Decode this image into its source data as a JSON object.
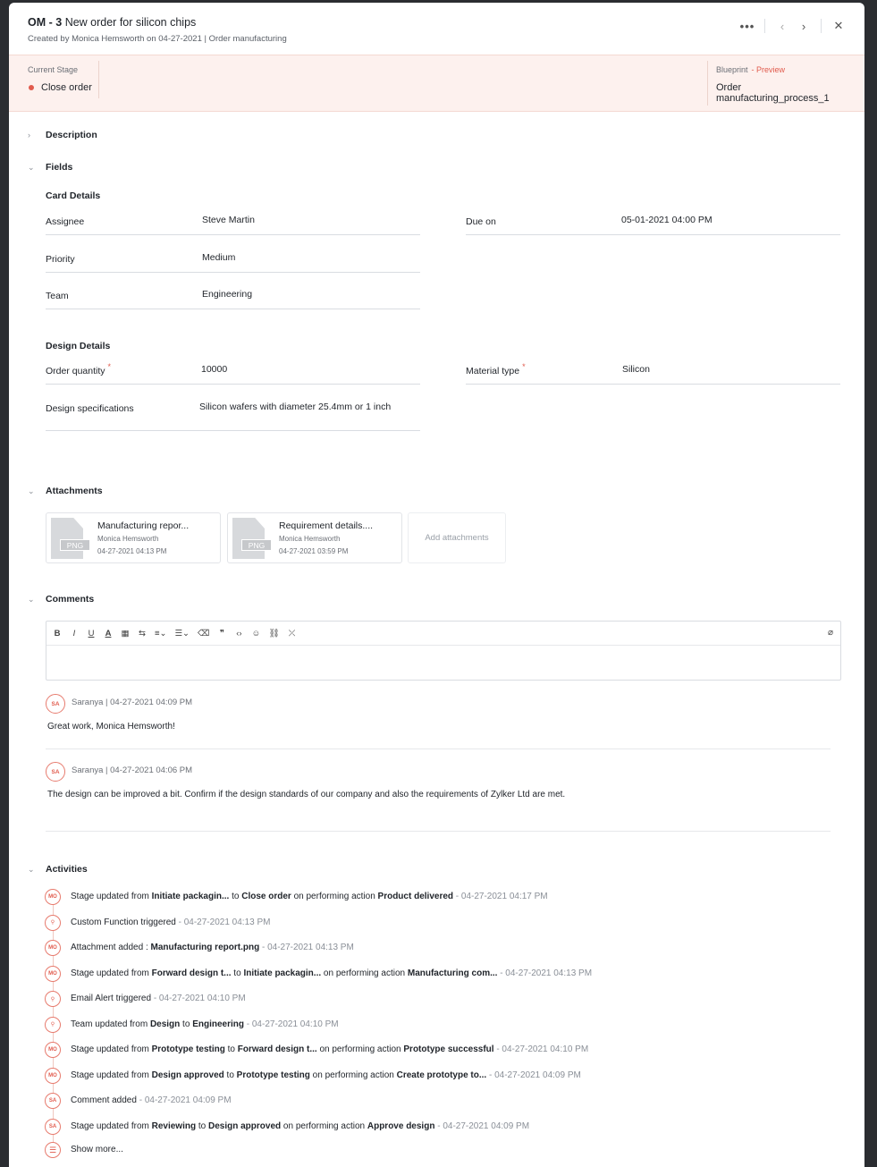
{
  "header": {
    "id": "OM - 3",
    "title": "New order for silicon chips",
    "subtitle": "Created by Monica Hemsworth on 04-27-2021 | Order manufacturing"
  },
  "stage": {
    "label": "Current Stage",
    "value": "Close order",
    "dot_color": "#e15b4d",
    "blueprint_label": "Blueprint",
    "preview_label": "- Preview",
    "blueprint_value": "Order manufacturing_process_1"
  },
  "sections": {
    "description": "Description",
    "fields": "Fields",
    "attachments": "Attachments",
    "comments": "Comments",
    "activities": "Activities"
  },
  "card_details": {
    "heading": "Card Details",
    "assignee_label": "Assignee",
    "assignee": "Steve Martin",
    "due_label": "Due on",
    "due": "05-01-2021 04:00 PM",
    "priority_label": "Priority",
    "priority": "Medium",
    "team_label": "Team",
    "team": "Engineering"
  },
  "design_details": {
    "heading": "Design Details",
    "qty_label": "Order quantity",
    "qty": "10000",
    "material_label": "Material type",
    "material": "Silicon",
    "spec_label": "Design specifications",
    "spec": "Silicon wafers with diameter 25.4mm or 1 inch"
  },
  "attachments": [
    {
      "name": "Manufacturing repor...",
      "by": "Monica Hemsworth",
      "date": "04-27-2021 04:13 PM",
      "type": "PNG"
    },
    {
      "name": "Requirement details....",
      "by": "Monica Hemsworth",
      "date": "04-27-2021 03:59 PM",
      "type": "PNG"
    }
  ],
  "add_attachments": "Add attachments",
  "comments": [
    {
      "initials": "SA",
      "meta": "Saranya | 04-27-2021 04:09 PM",
      "body": "Great work, Monica Hemsworth!"
    },
    {
      "initials": "SA",
      "meta": "Saranya | 04-27-2021 04:06 PM",
      "body": "The design can be improved a bit. Confirm if the design standards of our company and also the requirements of Zylker Ltd are met."
    }
  ],
  "activities": [
    {
      "initials": "MO",
      "parts": [
        "Stage updated from ",
        "Initiate packagin...",
        " to ",
        "Close order",
        " on performing action ",
        "Product delivered"
      ],
      "ts": "  - 04-27-2021 04:17 PM"
    },
    {
      "initials": "⚲",
      "parts": [
        "Custom Function triggered"
      ],
      "ts": "  - 04-27-2021 04:13 PM"
    },
    {
      "initials": "MO",
      "parts": [
        "Attachment added : ",
        "Manufacturing report.png"
      ],
      "ts": "  - 04-27-2021 04:13 PM"
    },
    {
      "initials": "MO",
      "parts": [
        "Stage updated from ",
        "Forward design t...",
        " to ",
        "Initiate packagin...",
        " on performing action ",
        "Manufacturing com..."
      ],
      "ts": "  - 04-27-2021 04:13 PM"
    },
    {
      "initials": "⚲",
      "parts": [
        "Email Alert triggered"
      ],
      "ts": "  - 04-27-2021 04:10 PM"
    },
    {
      "initials": "⚲",
      "parts": [
        "Team updated from ",
        "Design",
        " to ",
        "Engineering"
      ],
      "ts": "  - 04-27-2021 04:10 PM"
    },
    {
      "initials": "MO",
      "parts": [
        "Stage updated from ",
        "Prototype testing",
        " to ",
        "Forward design t...",
        " on performing action ",
        "Prototype successful"
      ],
      "ts": "  - 04-27-2021 04:10 PM"
    },
    {
      "initials": "MO",
      "parts": [
        "Stage updated from ",
        "Design approved",
        " to ",
        "Prototype testing",
        " on performing action ",
        "Create prototype to..."
      ],
      "ts": "  - 04-27-2021 04:09 PM"
    },
    {
      "initials": "SA",
      "parts": [
        "Comment added"
      ],
      "ts": "  - 04-27-2021 04:09 PM"
    },
    {
      "initials": "SA",
      "parts": [
        "Stage updated from ",
        "Reviewing",
        " to ",
        "Design approved",
        " on performing action ",
        "Approve design"
      ],
      "ts": "  - 04-27-2021 04:09 PM"
    }
  ],
  "show_more": "Show more..."
}
